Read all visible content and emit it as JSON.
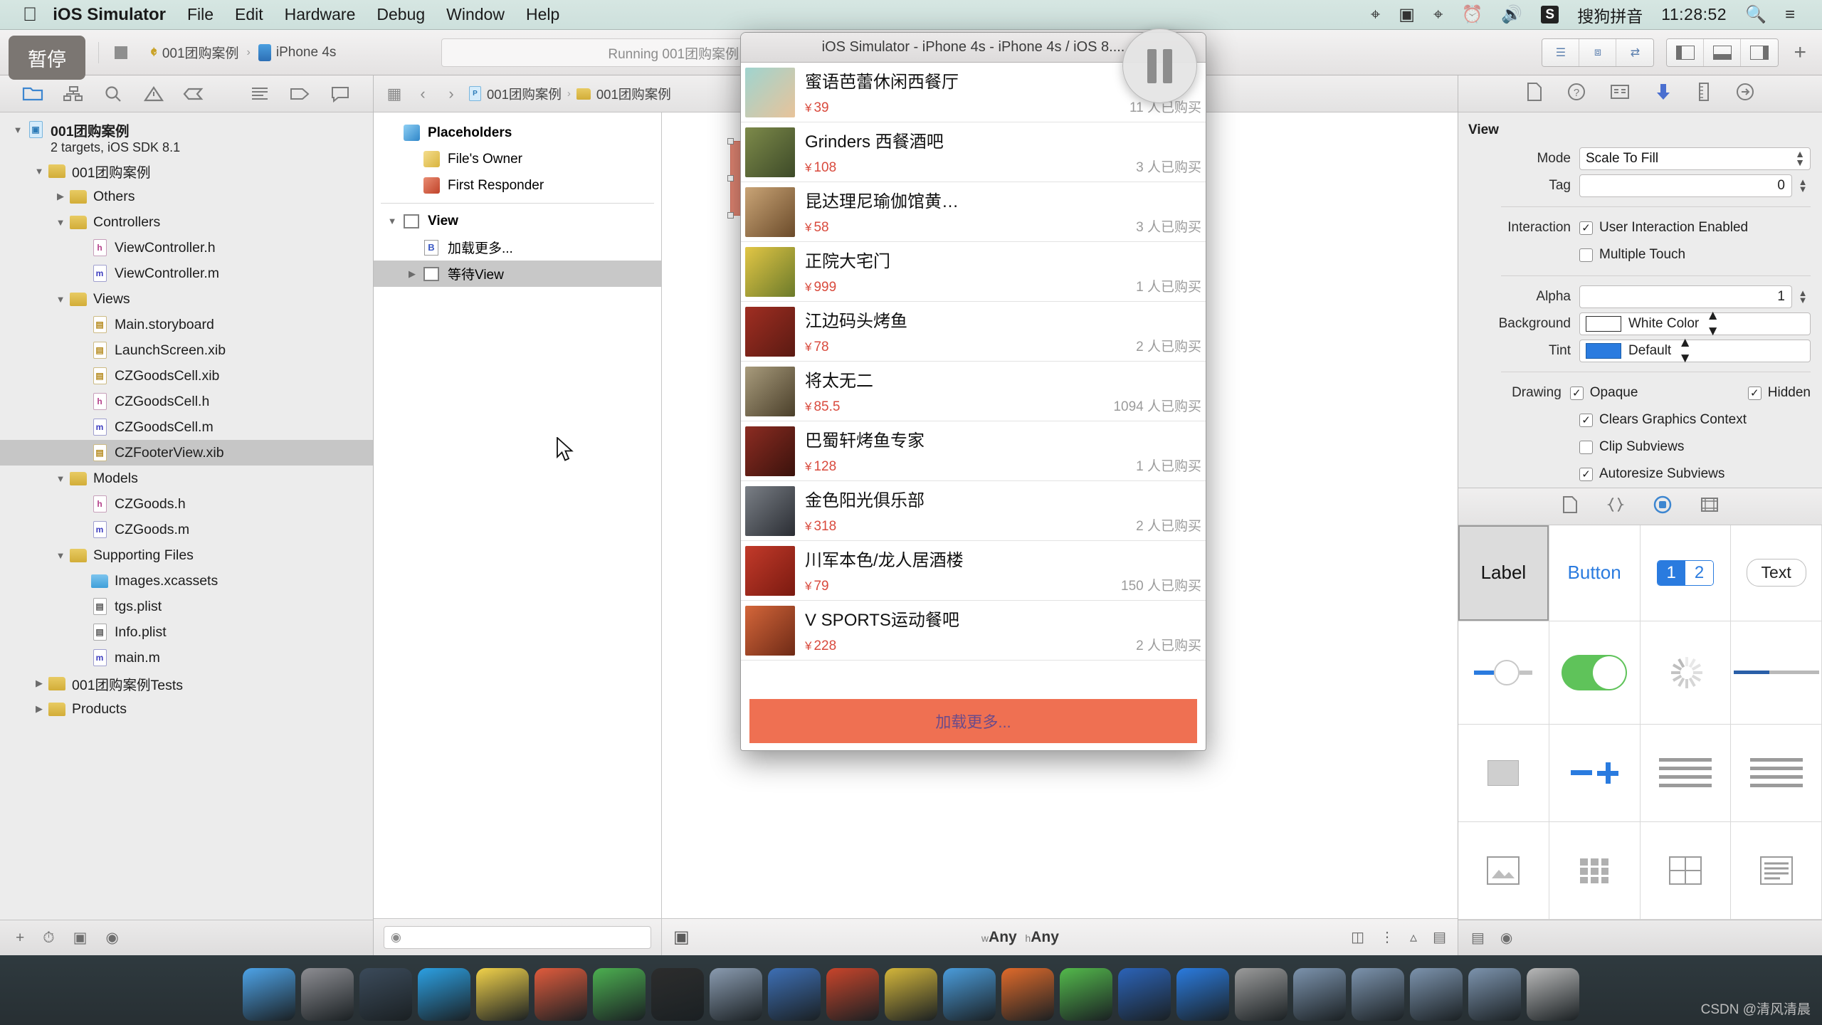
{
  "menubar": {
    "apple_icon": "apple-logo",
    "app_name": "iOS Simulator",
    "items": [
      "File",
      "Edit",
      "Hardware",
      "Debug",
      "Window",
      "Help"
    ],
    "status_icons": [
      "bluetooth-icon",
      "screen-record-icon",
      "airplay-icon",
      "timemachine-icon",
      "volume-icon"
    ],
    "input_method_badge": "S",
    "input_method": "搜狗拼音",
    "clock": "11:28:52",
    "search_icon": "search-icon",
    "notifications_icon": "list-icon"
  },
  "tooltip": {
    "pause_label": "暂停"
  },
  "toolbar": {
    "run_icon": "play-icon",
    "stop_icon": "stop-icon",
    "scheme_name": "001团购案例",
    "scheme_sep": "›",
    "device_name": "iPhone 4s",
    "activity_status": "Running 001团购案例 on ...",
    "editor_segments": [
      "standard-editor-icon",
      "assistant-editor-icon",
      "version-editor-icon"
    ],
    "view_segments": [
      "show-navigator-icon",
      "show-debug-area-icon",
      "show-utilities-icon"
    ],
    "add_label": "+"
  },
  "navigator": {
    "tabs": [
      "folder-icon",
      "hierarchy-icon",
      "search-icon",
      "warning-icon",
      "breakpoint-icon",
      "log-icon",
      "tag-icon",
      "comment-icon"
    ],
    "tree": [
      {
        "label": "001团购案例",
        "sub": "2 targets, iOS SDK 8.1",
        "depth": 0,
        "twisty": "▼",
        "icon": "project-icon",
        "bold": true,
        "selected": false
      },
      {
        "label": "001团购案例",
        "depth": 1,
        "twisty": "▼",
        "icon": "folder-icon",
        "selected": false
      },
      {
        "label": "Others",
        "depth": 2,
        "twisty": "▶",
        "icon": "folder-icon",
        "selected": false
      },
      {
        "label": "Controllers",
        "depth": 2,
        "twisty": "▼",
        "icon": "folder-icon",
        "selected": false
      },
      {
        "label": "ViewController.h",
        "depth": 3,
        "twisty": "",
        "icon": "header-file-icon",
        "selected": false
      },
      {
        "label": "ViewController.m",
        "depth": 3,
        "twisty": "",
        "icon": "source-file-icon",
        "selected": false
      },
      {
        "label": "Views",
        "depth": 2,
        "twisty": "▼",
        "icon": "folder-icon",
        "selected": false
      },
      {
        "label": "Main.storyboard",
        "depth": 3,
        "twisty": "",
        "icon": "storyboard-file-icon",
        "selected": false
      },
      {
        "label": "LaunchScreen.xib",
        "depth": 3,
        "twisty": "",
        "icon": "xib-file-icon",
        "selected": false
      },
      {
        "label": "CZGoodsCell.xib",
        "depth": 3,
        "twisty": "",
        "icon": "xib-file-icon",
        "selected": false
      },
      {
        "label": "CZGoodsCell.h",
        "depth": 3,
        "twisty": "",
        "icon": "header-file-icon",
        "selected": false
      },
      {
        "label": "CZGoodsCell.m",
        "depth": 3,
        "twisty": "",
        "icon": "source-file-icon",
        "selected": false
      },
      {
        "label": "CZFooterView.xib",
        "depth": 3,
        "twisty": "",
        "icon": "xib-file-icon",
        "selected": true
      },
      {
        "label": "Models",
        "depth": 2,
        "twisty": "▼",
        "icon": "folder-icon",
        "selected": false
      },
      {
        "label": "CZGoods.h",
        "depth": 3,
        "twisty": "",
        "icon": "header-file-icon",
        "selected": false
      },
      {
        "label": "CZGoods.m",
        "depth": 3,
        "twisty": "",
        "icon": "source-file-icon",
        "selected": false
      },
      {
        "label": "Supporting Files",
        "depth": 2,
        "twisty": "▼",
        "icon": "folder-icon",
        "selected": false
      },
      {
        "label": "Images.xcassets",
        "depth": 3,
        "twisty": "",
        "icon": "assets-icon",
        "selected": false
      },
      {
        "label": "tgs.plist",
        "depth": 3,
        "twisty": "",
        "icon": "plist-file-icon",
        "selected": false
      },
      {
        "label": "Info.plist",
        "depth": 3,
        "twisty": "",
        "icon": "plist-file-icon",
        "selected": false
      },
      {
        "label": "main.m",
        "depth": 3,
        "twisty": "",
        "icon": "source-file-icon",
        "selected": false
      },
      {
        "label": "001团购案例Tests",
        "depth": 1,
        "twisty": "▶",
        "icon": "folder-icon",
        "selected": false
      },
      {
        "label": "Products",
        "depth": 1,
        "twisty": "▶",
        "icon": "folder-icon",
        "selected": false
      }
    ],
    "footer_icons": [
      "add-icon",
      "recent-icon",
      "filter-icon",
      "source-control-icon"
    ]
  },
  "editor": {
    "back_icon": "chevron-left-icon",
    "forward_icon": "chevron-right-icon",
    "grid_icon": "related-items-icon",
    "breadcrumbs": [
      "001团购案例",
      "001团购案例"
    ],
    "outline": {
      "rows": [
        {
          "label": "Placeholders",
          "depth": 0,
          "twisty": "",
          "icon": "placeholders-cube-icon",
          "bold": true,
          "selected": false
        },
        {
          "label": "File's Owner",
          "depth": 1,
          "twisty": "",
          "icon": "files-owner-cube-icon",
          "selected": false
        },
        {
          "label": "First Responder",
          "depth": 1,
          "twisty": "",
          "icon": "first-responder-cube-icon",
          "selected": false
        },
        {
          "label": "View",
          "depth": 0,
          "twisty": "▼",
          "icon": "view-icon",
          "bold": true,
          "selected": false
        },
        {
          "label": "加载更多...",
          "depth": 1,
          "twisty": "",
          "icon": "button-icon",
          "selected": false
        },
        {
          "label": "等待View",
          "depth": 1,
          "twisty": "▶",
          "icon": "view-icon",
          "selected": true
        }
      ],
      "filter_placeholder": ""
    },
    "canvas_label": "View",
    "size_class": "wAny hAny",
    "size_class_w": "w",
    "size_class_h": "h",
    "bottom_icons": [
      "device-orientation-icon",
      "align-icon",
      "pin-icon",
      "resolve-icon",
      "resize-icon"
    ]
  },
  "inspector": {
    "tabs": [
      "file-inspector-icon",
      "quick-help-icon",
      "identity-inspector-icon",
      "attributes-inspector-icon",
      "size-inspector-icon",
      "connections-inspector-icon"
    ],
    "section_title": "View",
    "mode_label": "Mode",
    "mode_value": "Scale To Fill",
    "tag_label": "Tag",
    "tag_value": "0",
    "interaction_label": "Interaction",
    "interaction_user_enabled": {
      "label": "User Interaction Enabled",
      "checked": true
    },
    "interaction_multiple_touch": {
      "label": "Multiple Touch",
      "checked": false
    },
    "alpha_label": "Alpha",
    "alpha_value": "1",
    "background_label": "Background",
    "background_value": "White Color",
    "background_color": "#ffffff",
    "tint_label": "Tint",
    "tint_value": "Default",
    "tint_color": "#2a7bdf",
    "drawing_label": "Drawing",
    "drawing_opaque": {
      "label": "Opaque",
      "checked": true
    },
    "drawing_hidden": {
      "label": "Hidden",
      "checked": true
    },
    "drawing_clears": {
      "label": "Clears Graphics Context",
      "checked": true
    },
    "drawing_clip": {
      "label": "Clip Subviews",
      "checked": false
    },
    "drawing_autoresize": {
      "label": "Autoresize Subviews",
      "checked": true
    }
  },
  "library": {
    "tabs": [
      "file-template-library-icon",
      "code-snippet-library-icon",
      "object-library-icon",
      "media-library-icon"
    ],
    "objects": [
      {
        "name": "Label",
        "icon": "label-object",
        "selected": true
      },
      {
        "name": "Button",
        "icon": "button-object",
        "selected": false
      },
      {
        "name": "Segmented Control",
        "icon": "segmented-control-object",
        "labels": [
          "1",
          "2"
        ],
        "selected": false
      },
      {
        "name": "Text Field",
        "icon": "text-field-object",
        "label": "Text",
        "selected": false
      },
      {
        "name": "Slider",
        "icon": "slider-object",
        "selected": false
      },
      {
        "name": "Switch",
        "icon": "switch-object",
        "selected": false
      },
      {
        "name": "Activity Indicator",
        "icon": "activity-indicator-object",
        "selected": false
      },
      {
        "name": "Progress View",
        "icon": "progress-view-object",
        "selected": false
      },
      {
        "name": "Page Control",
        "icon": "page-control-object",
        "selected": false
      },
      {
        "name": "Stepper",
        "icon": "stepper-object",
        "selected": false
      },
      {
        "name": "Table View",
        "icon": "table-view-object",
        "selected": false
      },
      {
        "name": "Table View Cell",
        "icon": "table-view-cell-object",
        "selected": false
      },
      {
        "name": "Image View",
        "icon": "image-view-object",
        "selected": false
      },
      {
        "name": "Collection View",
        "icon": "collection-view-object",
        "selected": false
      },
      {
        "name": "Collection View Cell",
        "icon": "collection-view-cell-object",
        "selected": false
      },
      {
        "name": "Text View",
        "icon": "text-view-object",
        "selected": false
      }
    ],
    "footer_icons": [
      "list-view-icon",
      "filter-icon"
    ]
  },
  "simulator": {
    "window_title": "iOS Simulator - iPhone 4s - iPhone 4s / iOS 8....",
    "load_more_label": "加载更多...",
    "buy_suffix": "人已购买",
    "currency": "¥",
    "items": [
      {
        "name": "蜜语芭蕾休闲西餐厅",
        "price": "39",
        "buyers": "11",
        "thumb_from": "#9fd4cf",
        "thumb_to": "#e8c39a"
      },
      {
        "name": "Grinders 西餐酒吧",
        "price": "108",
        "buyers": "3",
        "thumb_from": "#7d8a4a",
        "thumb_to": "#3d4a28"
      },
      {
        "name": "昆达理尼瑜伽馆黄…",
        "price": "58",
        "buyers": "3",
        "thumb_from": "#c9a476",
        "thumb_to": "#6b4b2a"
      },
      {
        "name": "正院大宅门",
        "price": "999",
        "buyers": "1",
        "thumb_from": "#e2c645",
        "thumb_to": "#6b7a2a"
      },
      {
        "name": "江边码头烤鱼",
        "price": "78",
        "buyers": "2",
        "thumb_from": "#a02e22",
        "thumb_to": "#5a1a12"
      },
      {
        "name": "将太无二",
        "price": "85.5",
        "buyers": "1094",
        "thumb_from": "#a89b7c",
        "thumb_to": "#4a3f2a"
      },
      {
        "name": "巴蜀轩烤鱼专家",
        "price": "128",
        "buyers": "1",
        "thumb_from": "#8c2c22",
        "thumb_to": "#3a120c"
      },
      {
        "name": "金色阳光俱乐部",
        "price": "318",
        "buyers": "2",
        "thumb_from": "#7a7f86",
        "thumb_to": "#2a2d33"
      },
      {
        "name": "川军本色/龙人居酒楼",
        "price": "79",
        "buyers": "150",
        "thumb_from": "#c23a2a",
        "thumb_to": "#7a1a10"
      },
      {
        "name": "V SPORTS运动餐吧",
        "price": "228",
        "buyers": "2",
        "thumb_from": "#d4663a",
        "thumb_to": "#6e2a16"
      }
    ]
  },
  "dock": {
    "apps": [
      "finder",
      "system-preferences",
      "launchpad",
      "safari",
      "notes",
      "xmind",
      "evernote",
      "terminal",
      "simulator",
      "xcode",
      "powerpoint",
      "snip",
      "chrome",
      "filezilla",
      "wechat",
      "word",
      "app-store",
      "font-book",
      "folder1",
      "folder2",
      "folder3",
      "folder4",
      "trash"
    ]
  },
  "watermark": "CSDN @清风清晨"
}
